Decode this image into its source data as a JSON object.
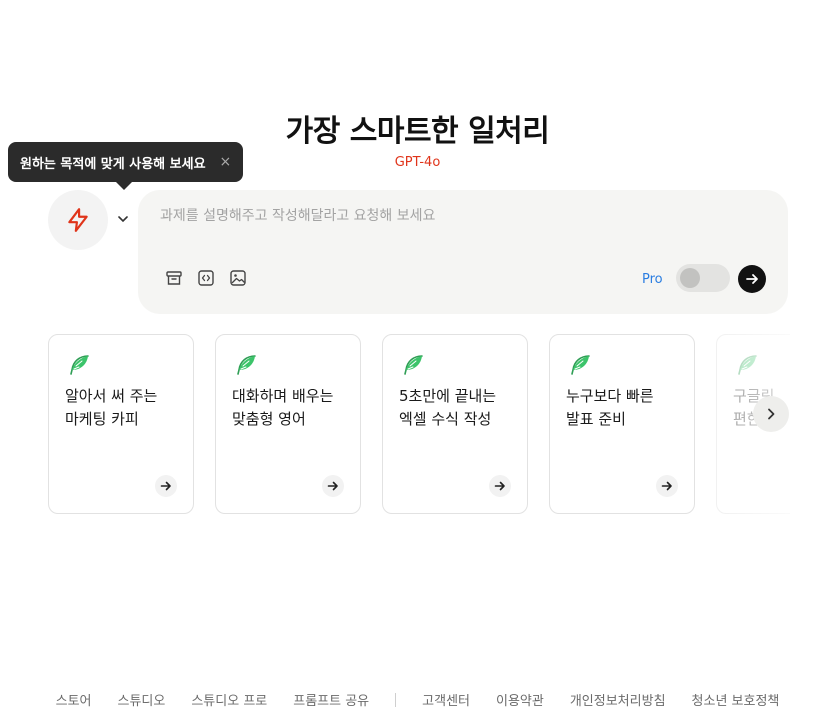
{
  "hero": {
    "title": "가장 스마트한 일처리",
    "model": "GPT-4o"
  },
  "tooltip": {
    "text": "원하는 목적에 맞게 사용해 보세요",
    "close": "×"
  },
  "composer": {
    "placeholder": "과제를 설명해주고 작성해달라고 요청해 보세요",
    "pro_label": "Pro",
    "pro_enabled": false,
    "tools": [
      "archive-icon",
      "code-icon",
      "image-icon"
    ]
  },
  "cards": [
    {
      "line1": "알아서 써 주는",
      "line2": "마케팅 카피"
    },
    {
      "line1": "대화하며 배우는",
      "line2": "맞춤형 영어"
    },
    {
      "line1": "5초만에 끝내는",
      "line2": "엑셀 수식 작성"
    },
    {
      "line1": "누구보다 빠른",
      "line2": "발표 준비"
    },
    {
      "line1": "구글링",
      "line2": "편한"
    }
  ],
  "footer": {
    "left": [
      "스토어",
      "스튜디오",
      "스튜디오 프로",
      "프롬프트 공유"
    ],
    "right": [
      "고객센터",
      "이용약관",
      "개인정보처리방침",
      "청소년 보호정책"
    ]
  },
  "colors": {
    "accent_red": "#e0341a",
    "pro_blue": "#2a7de1",
    "feather_green": "#3cc46a"
  }
}
